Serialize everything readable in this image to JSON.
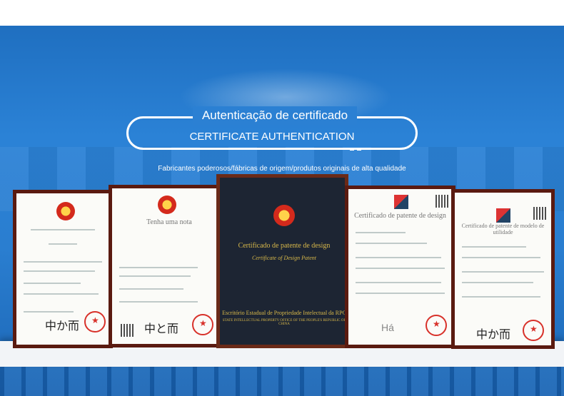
{
  "header": {
    "title_pt": "Autenticação de certificado",
    "title_en": "CERTIFICATE AUTHENTICATION",
    "subtitle": "Fabricantes poderosos/fábricas de origem/produtos originais de alta qualidade"
  },
  "certificates": [
    {
      "label": ""
    },
    {
      "label": "Tenha uma nota"
    },
    {
      "label": "Certificado de patente de design",
      "label_en": "Certificate of Design Patent",
      "office": "Escritório Estadual de Propriedade Intelectual da RPC",
      "office_en": "STATE INTELLECTUAL PROPERTY OFFICE OF THE PEOPLE'S REPUBLIC OF CHINA"
    },
    {
      "label": "Certificado de patente de design",
      "stamp": "Há"
    },
    {
      "label": "Certificado de patente de modelo de utilidade"
    }
  ],
  "colors": {
    "banner": "#2b80d3",
    "frame": "#5a1a10",
    "seal": "#d8312a"
  }
}
